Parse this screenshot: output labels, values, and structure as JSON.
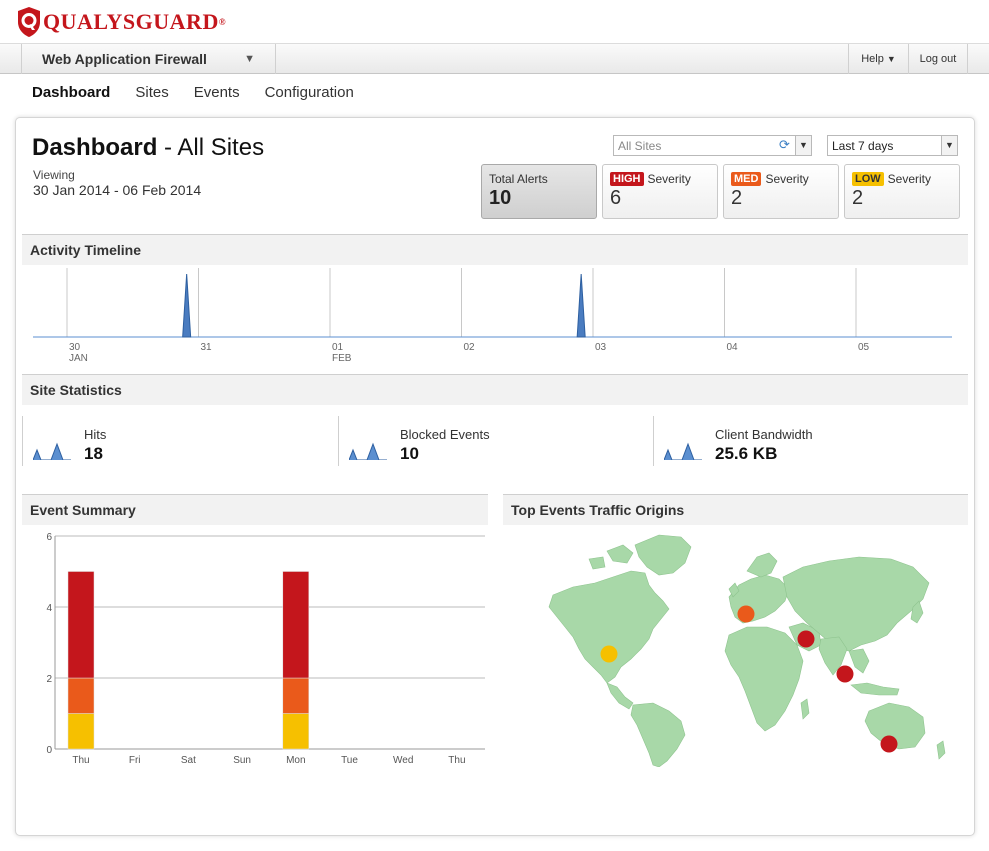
{
  "brand": {
    "name": "QUALYSGUARD",
    "reg_mark": "®"
  },
  "topbar": {
    "app_name": "Web Application Firewall",
    "help_label": "Help",
    "logout_label": "Log out"
  },
  "nav": {
    "items": [
      "Dashboard",
      "Sites",
      "Events",
      "Configuration"
    ],
    "active": "Dashboard"
  },
  "header": {
    "title_bold": "Dashboard",
    "title_rest": "- All Sites",
    "viewing_label": "Viewing",
    "date_range": "30 Jan 2014 - 06 Feb 2014",
    "site_select_placeholder": "All Sites",
    "range_select_value": "Last 7 days"
  },
  "stats": {
    "total": {
      "label": "Total Alerts",
      "value": "10"
    },
    "high": {
      "badge": "HIGH",
      "label": "Severity",
      "value": "6"
    },
    "med": {
      "badge": "MED",
      "label": "Severity",
      "value": "2"
    },
    "low": {
      "badge": "LOW",
      "label": "Severity",
      "value": "2"
    }
  },
  "activity_timeline": {
    "title": "Activity Timeline",
    "ticks": [
      {
        "day": "30",
        "month": "JAN"
      },
      {
        "day": "31",
        "month": ""
      },
      {
        "day": "01",
        "month": "FEB"
      },
      {
        "day": "02",
        "month": ""
      },
      {
        "day": "03",
        "month": ""
      },
      {
        "day": "04",
        "month": ""
      },
      {
        "day": "05",
        "month": ""
      }
    ],
    "spikes_fraction_of_day_axis": [
      0.91,
      3.91
    ]
  },
  "site_statistics": {
    "title": "Site Statistics",
    "items": [
      {
        "label": "Hits",
        "value": "18"
      },
      {
        "label": "Blocked Events",
        "value": "10"
      },
      {
        "label": "Client Bandwidth",
        "value": "25.6 KB"
      }
    ]
  },
  "event_summary": {
    "title": "Event Summary"
  },
  "chart_data": {
    "type": "bar",
    "stacked": true,
    "categories": [
      "Thu",
      "Fri",
      "Sat",
      "Sun",
      "Mon",
      "Tue",
      "Wed",
      "Thu"
    ],
    "series": [
      {
        "name": "LOW",
        "color": "#f6c000",
        "values": [
          1,
          0,
          0,
          0,
          1,
          0,
          0,
          0
        ]
      },
      {
        "name": "MED",
        "color": "#ea5a1b",
        "values": [
          1,
          0,
          0,
          0,
          1,
          0,
          0,
          0
        ]
      },
      {
        "name": "HIGH",
        "color": "#c4161c",
        "values": [
          3,
          0,
          0,
          0,
          3,
          0,
          0,
          0
        ]
      }
    ],
    "yticks": [
      0,
      2,
      4,
      6
    ],
    "ylim": [
      0,
      6
    ],
    "grid": true
  },
  "traffic_origins": {
    "title": "Top Events Traffic Origins",
    "land_color": "#a8d8a8",
    "markers": [
      {
        "region": "USA West",
        "severity": "low",
        "color": "#f6c000"
      },
      {
        "region": "Europe",
        "severity": "med",
        "color": "#ea5a1b"
      },
      {
        "region": "China",
        "severity": "high",
        "color": "#c4161c"
      },
      {
        "region": "Southeast Asia",
        "severity": "high",
        "color": "#c4161c"
      },
      {
        "region": "Australia",
        "severity": "high",
        "color": "#c4161c"
      }
    ]
  }
}
